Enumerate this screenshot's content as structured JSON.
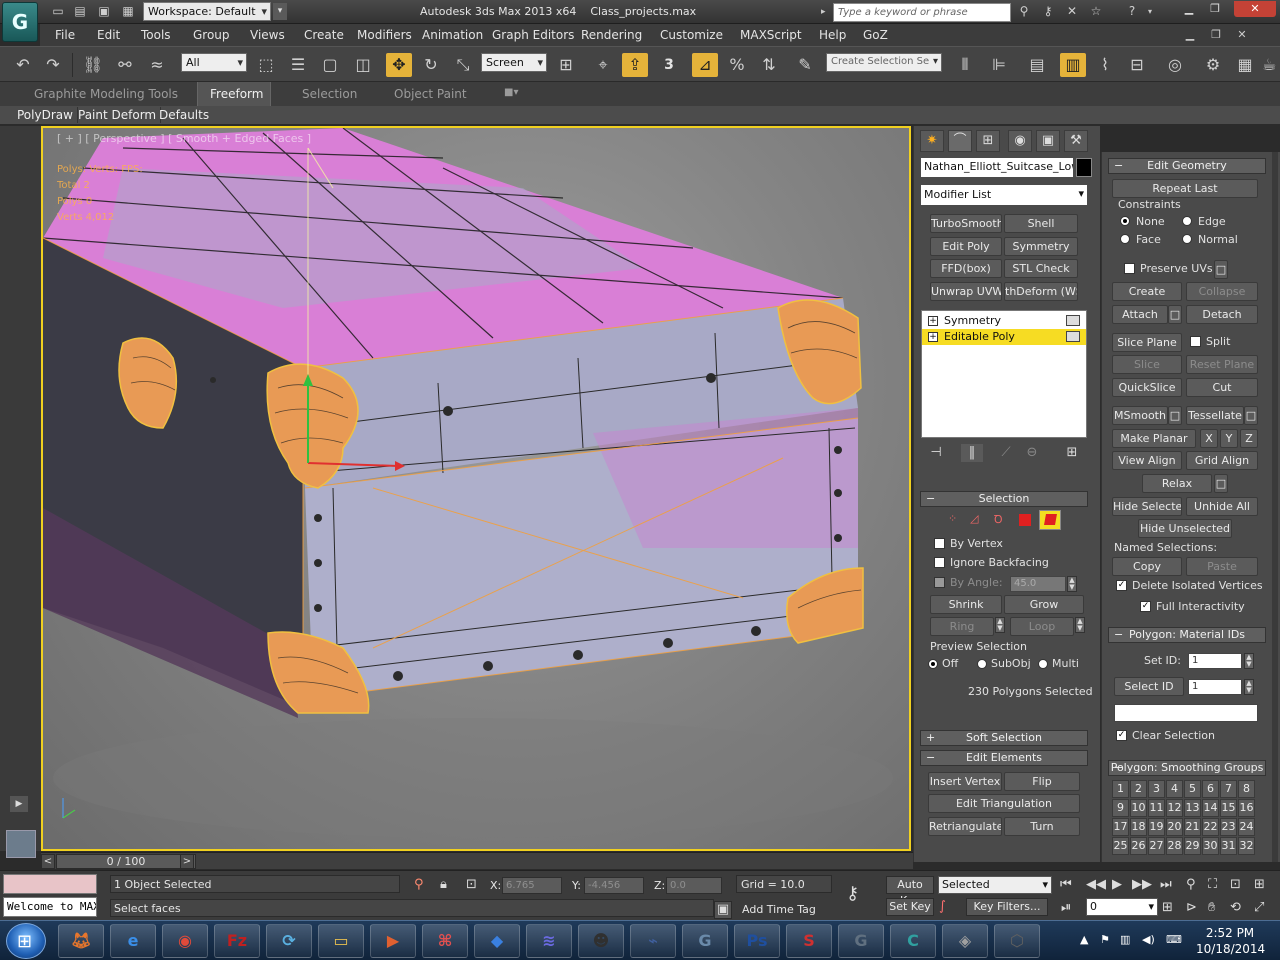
{
  "window": {
    "app_title": "Autodesk 3ds Max  2013 x64",
    "file_name": "Class_projects.max",
    "workspace": "Workspace: Default",
    "search_placeholder": "Type a keyword or phrase",
    "logo": "G"
  },
  "menu": [
    "File",
    "Edit",
    "Tools",
    "Group",
    "Views",
    "Create",
    "Modifiers",
    "Animation",
    "Graph Editors",
    "Rendering",
    "Customize",
    "MAXScript",
    "Help",
    "GoZ"
  ],
  "toolbar": {
    "selection_filter": "All",
    "ref_coord": "Screen",
    "snap_number": "3",
    "named_selection": "Create Selection Se"
  },
  "ribbon": {
    "tabs": [
      "Graphite Modeling Tools",
      "Freeform",
      "Selection",
      "Object Paint"
    ],
    "active_tab": "Freeform",
    "panels": [
      "PolyDraw",
      "Paint Deform",
      "Defaults"
    ]
  },
  "viewport": {
    "label": "[ + ] [ Perspective ] [ Smooth + Edged Faces ]",
    "stats_title": "Polys:   Verts:  FPS:",
    "stats": [
      "Total       2",
      "Polys       0",
      "Verts   4,012"
    ]
  },
  "command_panel": {
    "object_name": "Nathan_Elliott_Suitcase_Lowpoly",
    "modifier_list": "Modifier List",
    "modifier_buttons": [
      "TurboSmooth",
      "Shell",
      "Edit Poly",
      "Symmetry",
      "FFD(box)",
      "STL Check",
      "Unwrap UVW",
      "thDeform (WSI"
    ],
    "stack": [
      "Symmetry",
      "Editable Poly"
    ],
    "selection": {
      "title": "Selection",
      "by_vertex": "By Vertex",
      "ignore_backfacing": "Ignore Backfacing",
      "by_angle": "By Angle:",
      "angle_value": "45.0",
      "shrink": "Shrink",
      "grow": "Grow",
      "ring": "Ring",
      "loop": "Loop",
      "preview_title": "Preview Selection",
      "preview_options": [
        "Off",
        "SubObj",
        "Multi"
      ],
      "status": "230 Polygons Selected"
    },
    "soft_selection": "Soft Selection",
    "edit_elements": {
      "title": "Edit Elements",
      "insert_vertex": "Insert Vertex",
      "flip": "Flip",
      "edit_triangulation": "Edit Triangulation",
      "retriangulate": "Retriangulate",
      "turn": "Turn"
    }
  },
  "edit_geometry": {
    "title": "Edit Geometry",
    "repeat_last": "Repeat Last",
    "constraints": "Constraints",
    "constraint_options": [
      "None",
      "Edge",
      "Face",
      "Normal"
    ],
    "preserve_uvs": "Preserve UVs",
    "create": "Create",
    "collapse": "Collapse",
    "attach": "Attach",
    "detach": "Detach",
    "slice_plane": "Slice Plane",
    "split": "Split",
    "slice": "Slice",
    "reset_plane": "Reset Plane",
    "quickslice": "QuickSlice",
    "cut": "Cut",
    "msmooth": "MSmooth",
    "tessellate": "Tessellate",
    "make_planar": "Make Planar",
    "x": "X",
    "y": "Y",
    "z": "Z",
    "view_align": "View Align",
    "grid_align": "Grid Align",
    "relax": "Relax",
    "hide_selected": "Hide Selected",
    "unhide_all": "Unhide All",
    "hide_unselected": "Hide Unselected",
    "named_selections": "Named Selections:",
    "copy": "Copy",
    "paste": "Paste",
    "delete_isolated": "Delete Isolated Vertices",
    "full_interactivity": "Full Interactivity",
    "material_title": "Polygon: Material IDs",
    "set_id": "Set ID:",
    "set_id_value": "1",
    "select_id": "Select ID",
    "select_id_value": "1",
    "clear_selection": "Clear Selection",
    "smoothing_title": "Polygon: Smoothing Groups",
    "smoothing_groups": [
      "1",
      "2",
      "3",
      "4",
      "5",
      "6",
      "7",
      "8",
      "9",
      "10",
      "11",
      "12",
      "13",
      "14",
      "15",
      "16",
      "17",
      "18",
      "19",
      "20",
      "21",
      "22",
      "23",
      "24",
      "25",
      "26",
      "27",
      "28",
      "29",
      "30",
      "31",
      "32"
    ]
  },
  "timeline": {
    "frame": "0 / 100"
  },
  "status": {
    "maxscript": "Welcome to MAXScript.",
    "objects_selected": "1 Object Selected",
    "prompt": "Select faces",
    "x_label": "X:",
    "x_value": "6.765",
    "y_label": "Y:",
    "y_value": "-4.456",
    "z_label": "Z:",
    "z_value": "0.0",
    "grid": "Grid = 10.0",
    "add_time_tag": "Add Time Tag",
    "auto_key": "Auto Key",
    "set_key": "Set Key",
    "key_mode": "Selected",
    "key_filters": "Key Filters...",
    "current_frame": "0"
  },
  "taskbar": {
    "time": "2:52 PM",
    "date": "10/18/2014",
    "apps": [
      "Firefox",
      "IE",
      "Chrome",
      "FileZilla",
      "Sync",
      "Folder",
      "Media",
      "Stack",
      "Dropbox",
      "Sketch",
      "Mudbox",
      "Cygwin",
      "Max",
      "Ps",
      "Substance",
      "Max2",
      "C",
      "Unity",
      "Unreal"
    ]
  },
  "colors": {
    "accent_yellow": "#f0d020",
    "selection_magenta": "#d67bd6",
    "vertex_orange": "#f0a040"
  }
}
